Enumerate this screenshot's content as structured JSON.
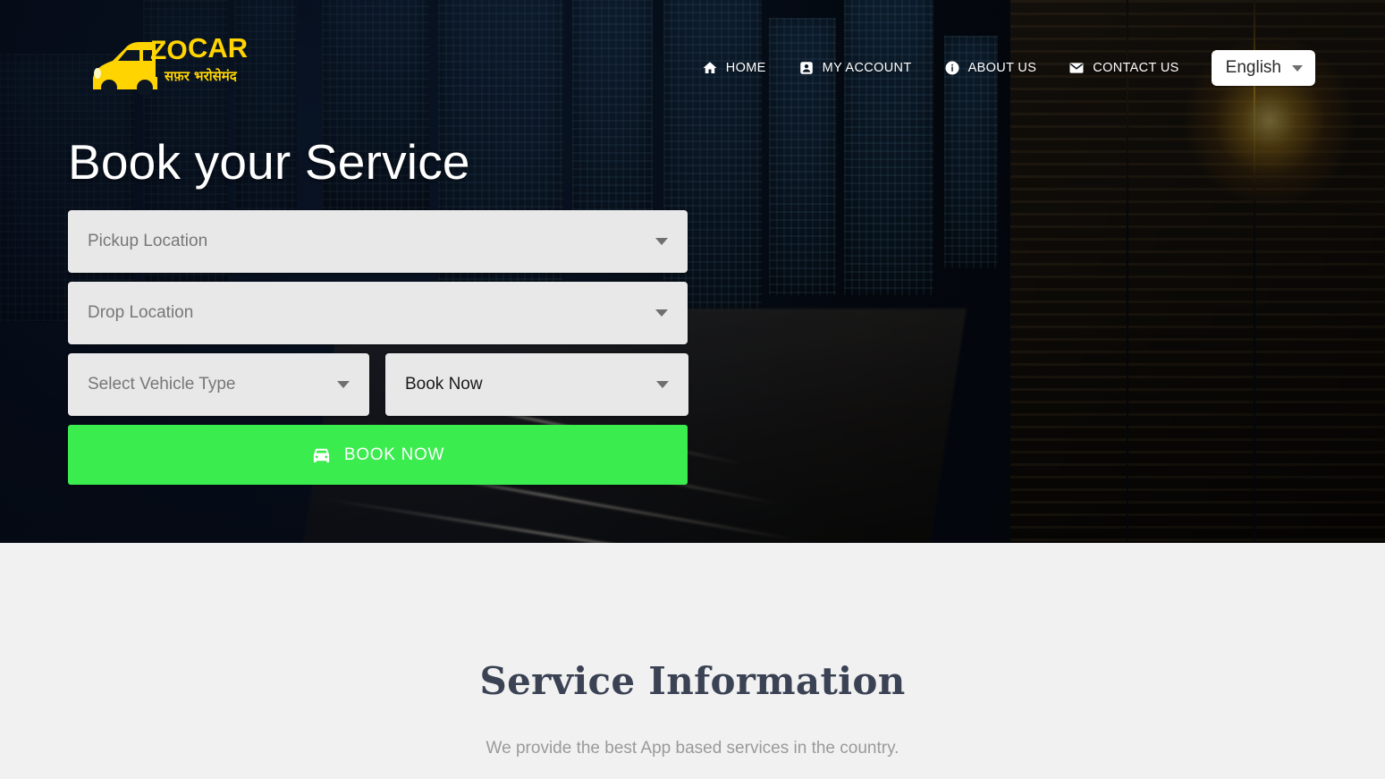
{
  "brand": {
    "name_part1": "ZO",
    "name_part2": "CAR",
    "tagline_hi": "सफ़र भरोसेमंद",
    "logo_color": "#FFD400"
  },
  "nav": {
    "items": [
      {
        "label": "HOME",
        "icon": "home-icon"
      },
      {
        "label": "MY ACCOUNT",
        "icon": "account-icon"
      },
      {
        "label": "ABOUT US",
        "icon": "info-icon"
      },
      {
        "label": "CONTACT US",
        "icon": "mail-icon"
      }
    ],
    "language": {
      "label": "English",
      "icon": "chevron-down-icon"
    }
  },
  "hero": {
    "title": "Book your Service",
    "fields": {
      "pickup": {
        "value": "Pickup Location",
        "is_placeholder": true
      },
      "drop": {
        "value": "Drop Location",
        "is_placeholder": true
      },
      "vehicle_type": {
        "value": "Select Vehicle Type",
        "is_placeholder": true
      },
      "booking_mode": {
        "value": "Book Now",
        "is_placeholder": false
      }
    },
    "submit": {
      "label": "BOOK NOW",
      "icon": "car-icon",
      "color": "#3BEC4F"
    }
  },
  "info": {
    "title": "Service Information",
    "subtitle": "We provide the best App based services in the country."
  }
}
